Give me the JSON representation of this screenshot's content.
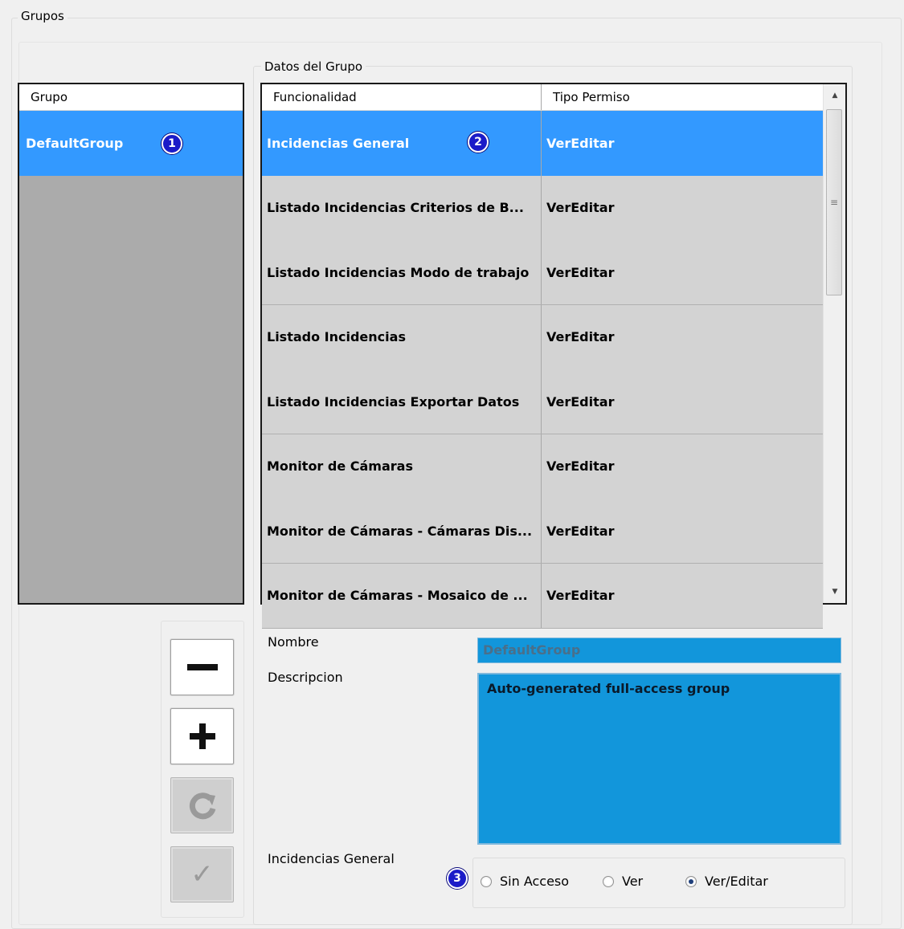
{
  "groups_frame": {
    "title": "Grupos"
  },
  "group_list": {
    "header": "Grupo",
    "rows": [
      {
        "name": "DefaultGroup",
        "badge": "1",
        "selected": true
      }
    ]
  },
  "datos": {
    "title": "Datos del Grupo",
    "columns": [
      "Funcionalidad",
      "Tipo Permiso"
    ],
    "badge": "2",
    "rows": [
      {
        "func": "Incidencias General",
        "perm": "VerEditar",
        "selected": true
      },
      {
        "func": "Listado Incidencias Criterios de B...",
        "perm": "VerEditar"
      },
      {
        "func": "Listado Incidencias Modo de trabajo",
        "perm": "VerEditar"
      },
      {
        "func": "Listado Incidencias",
        "perm": "VerEditar"
      },
      {
        "func": "Listado Incidencias Exportar Datos",
        "perm": "VerEditar"
      },
      {
        "func": "Monitor de Cámaras",
        "perm": "VerEditar"
      },
      {
        "func": "Monitor de Cámaras - Cámaras Dis...",
        "perm": "VerEditar"
      },
      {
        "func": "Monitor de Cámaras - Mosaico de ...",
        "perm": "VerEditar"
      }
    ]
  },
  "form": {
    "nombre_label": "Nombre",
    "nombre_value": "DefaultGroup",
    "descripcion_label": "Descripcion",
    "descripcion_value": "Auto-generated full-access group",
    "perm_label": "Incidencias General",
    "badge": "3",
    "options": [
      {
        "label": "Sin Acceso",
        "checked": false
      },
      {
        "label": "Ver",
        "checked": false
      },
      {
        "label": "Ver/Editar",
        "checked": true
      }
    ]
  },
  "buttons": {
    "remove": "minus-icon",
    "add": "plus-icon",
    "refresh": "refresh-icon",
    "confirm": "check-icon"
  },
  "colors": {
    "selection": "#3399ff",
    "field": "#1296db",
    "badge": "#1b1bc8"
  }
}
